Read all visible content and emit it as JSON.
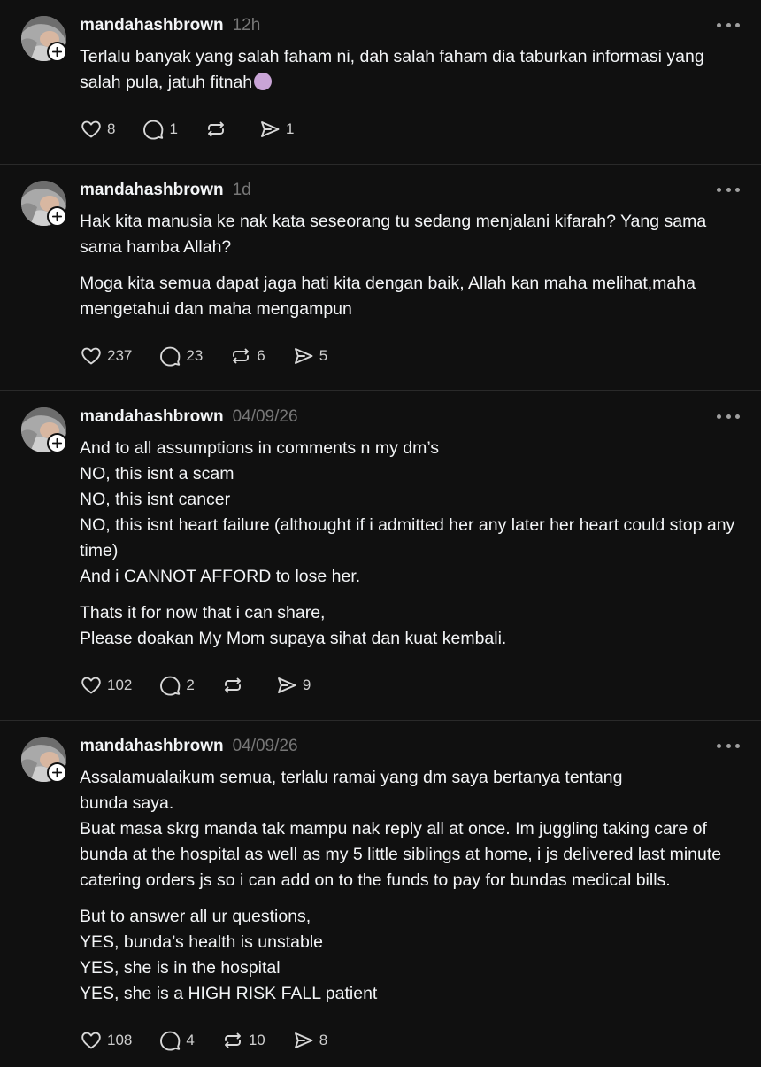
{
  "posts": [
    {
      "username": "mandahashbrown",
      "time": "12h",
      "paragraphs": [
        "Terlalu banyak yang salah faham ni, dah salah faham dia taburkan informasi yang salah pula, jatuh fitnah"
      ],
      "emoji": "person-shrugging-emoji",
      "likes": "8",
      "replies": "1",
      "reposts": "",
      "shares": "1"
    },
    {
      "username": "mandahashbrown",
      "time": "1d",
      "paragraphs": [
        "Hak kita manusia ke nak kata seseorang tu sedang menjalani kifarah? Yang sama sama hamba Allah?",
        "Moga kita semua dapat jaga hati kita dengan baik, Allah kan maha melihat,maha mengetahui dan maha mengampun"
      ],
      "likes": "237",
      "replies": "23",
      "reposts": "6",
      "shares": "5"
    },
    {
      "username": "mandahashbrown",
      "time": "04/09/26",
      "paragraphs": [
        "And to all assumptions in comments n my dm’s\nNO, this isnt a scam\nNO, this isnt cancer\nNO, this isnt heart failure (althought if i admitted her any later her heart could stop any time)\nAnd i CANNOT AFFORD to lose her.",
        "Thats it for now that i can share,\nPlease doakan My Mom supaya sihat dan kuat kembali."
      ],
      "likes": "102",
      "replies": "2",
      "reposts": "",
      "shares": "9"
    },
    {
      "username": "mandahashbrown",
      "time": "04/09/26",
      "paragraphs": [
        "Assalamualaikum semua, terlalu ramai yang dm saya bertanya tentang\nbunda saya.\nBuat masa skrg manda tak mampu nak reply all at once. Im juggling taking care of bunda at the hospital as well as my 5 little siblings at home, i js delivered last minute catering orders js so i can add on to the funds to pay for bundas medical bills.",
        "But to answer all ur questions,\nYES, bunda’s health is unstable\nYES, she is in the hospital\nYES, she is a HIGH RISK FALL patient"
      ],
      "likes": "108",
      "replies": "4",
      "reposts": "10",
      "shares": "8"
    }
  ],
  "icons": {
    "like": "heart-icon",
    "reply": "comment-icon",
    "repost": "repost-icon",
    "share": "send-icon",
    "more": "more-dots-icon",
    "follow": "plus-icon"
  },
  "colors": {
    "background": "#101010",
    "text": "#f3f5f7",
    "muted": "#777777",
    "divider": "#2a2a2a"
  }
}
